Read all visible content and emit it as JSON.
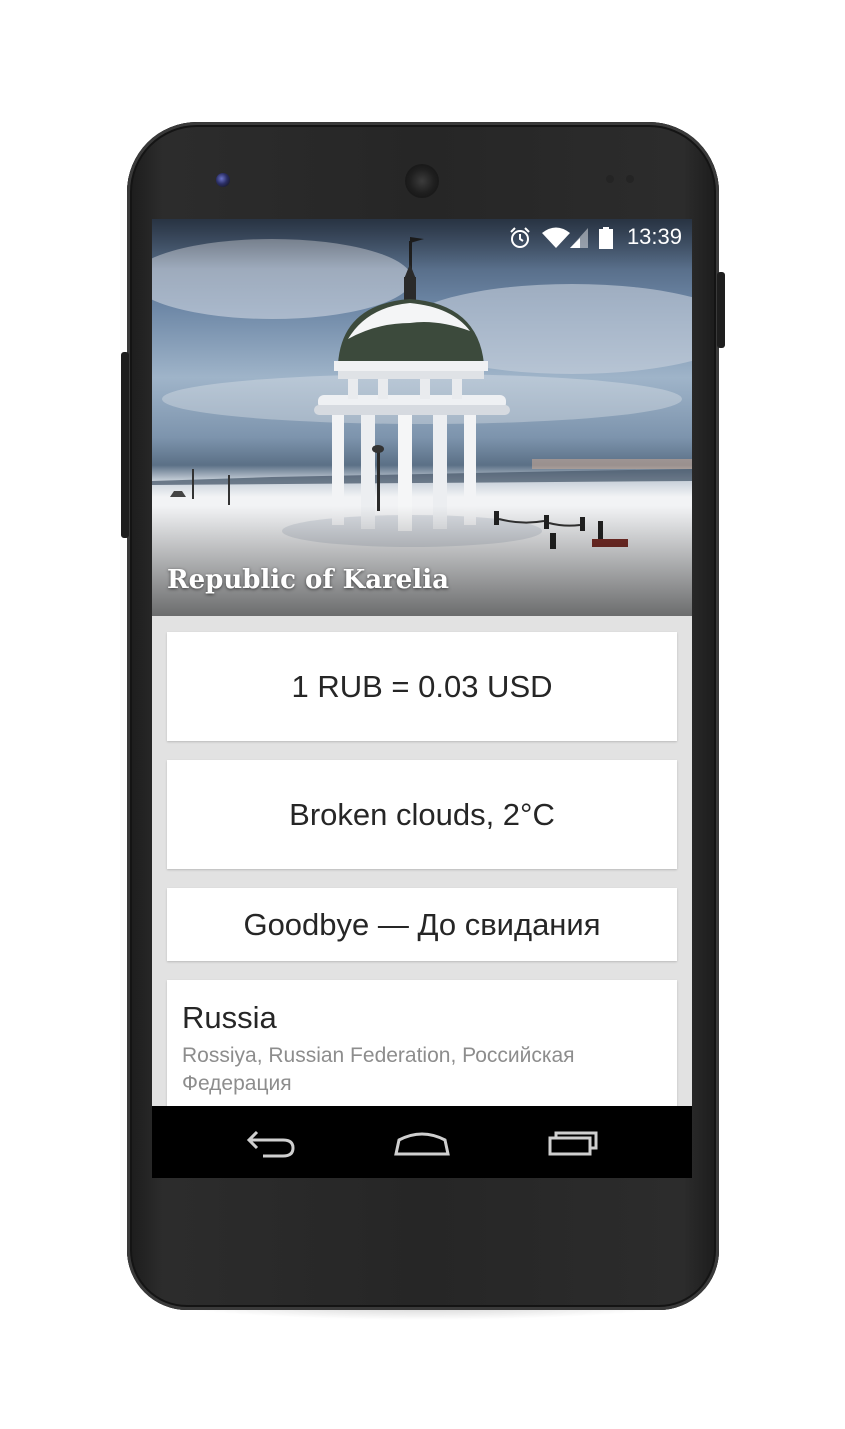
{
  "status_bar": {
    "time": "13:39",
    "icons": [
      "alarm-icon",
      "wifi-icon",
      "signal-icon",
      "battery-icon"
    ]
  },
  "hero": {
    "title": "Republic of Karelia"
  },
  "cards": {
    "currency": "1 RUB = 0.03 USD",
    "weather": "Broken clouds, 2°C",
    "phrase": "Goodbye — До свидания",
    "country": {
      "name": "Russia",
      "aliases": "Rossiya, Russian Federation, Российская Федерация"
    }
  },
  "nav_bar": {
    "buttons": [
      "back-icon",
      "home-icon",
      "recents-icon"
    ]
  },
  "colors": {
    "card_background": "#ffffff",
    "list_background": "#e2e2e2",
    "primary_text": "#262626",
    "secondary_text": "#8d8d8d",
    "nav_bar": "#000000"
  }
}
